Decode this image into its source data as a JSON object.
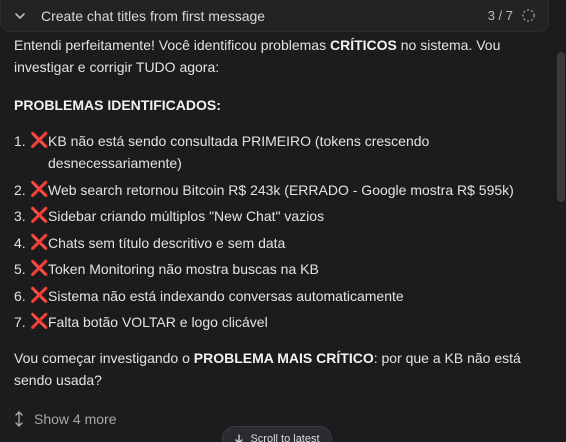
{
  "task": {
    "title": "Create chat titles from first message",
    "progress": "3 / 7",
    "icons": {
      "collapse": "chevron-down-icon",
      "status": "loading-spinner-icon"
    }
  },
  "message": {
    "intro": {
      "before": "Entendi perfeitamente! Você identificou problemas ",
      "bold": "CRÍTICOS",
      "after": " no sistema. Vou investigar e corrigir TUDO agora:"
    },
    "heading": "PROBLEMAS IDENTIFICADOS:",
    "items": [
      {
        "num": "1.",
        "icon": "❌",
        "text": "KB não está sendo consultada PRIMEIRO (tokens crescendo desnecessariamente)"
      },
      {
        "num": "2.",
        "icon": "❌",
        "text": "Web search retornou Bitcoin R$ 243k (ERRADO - Google mostra R$ 595k)"
      },
      {
        "num": "3.",
        "icon": "❌",
        "text": "Sidebar criando múltiplos \"New Chat\" vazios"
      },
      {
        "num": "4.",
        "icon": "❌",
        "text": "Chats sem título descritivo e sem data"
      },
      {
        "num": "5.",
        "icon": "❌",
        "text": "Token Monitoring não mostra buscas na KB"
      },
      {
        "num": "6.",
        "icon": "❌",
        "text": "Sistema não está indexando conversas automaticamente"
      },
      {
        "num": "7.",
        "icon": "❌",
        "text": "Falta botão VOLTAR e logo clicável"
      }
    ],
    "closing": {
      "before": "Vou começar investigando o ",
      "bold": "PROBLEMA MAIS CRÍTICO",
      "after": ": por que a KB não está sendo usada?"
    }
  },
  "show_more": {
    "label": "Show 4 more",
    "icon": "expand-vertical-icon"
  },
  "scroll_latest": {
    "label": "Scroll to latest",
    "icon": "arrow-down-icon"
  },
  "colors": {
    "background": "#1c1c1f",
    "cross": "#e0393e",
    "text": "#e3e3e3"
  }
}
